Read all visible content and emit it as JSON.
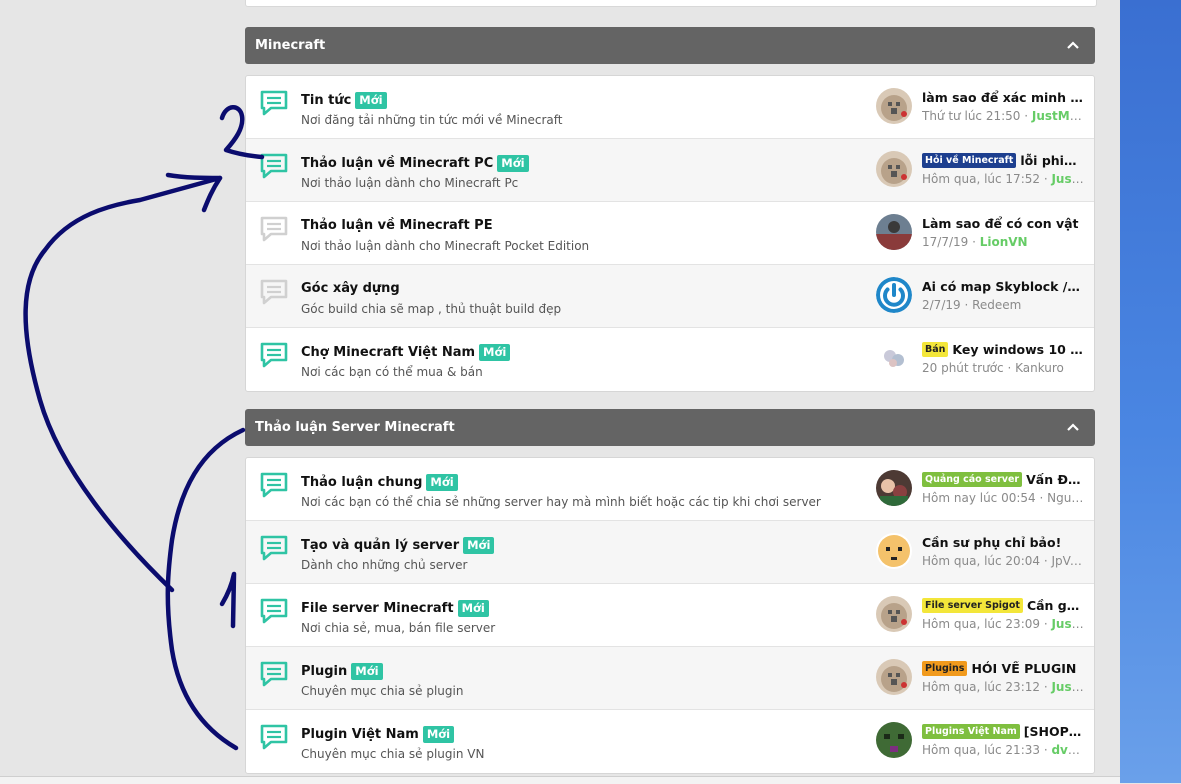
{
  "colors": {
    "accent": "#2fc4a4",
    "header_bg": "#646464",
    "ink": "#0b0c6e"
  },
  "sections": [
    {
      "title": "Minecraft",
      "nodes": [
        {
          "title": "Tin tức",
          "new": "Mới",
          "desc": "Nơi đăng tải những tin tức mới về Minecraft",
          "prefix": "",
          "prefix_bg": "",
          "prefix_fg": "",
          "last_title": "làm sao để xác minh v m...",
          "time": "Thứ tư lúc 21:50",
          "sep": " · ",
          "user": "JustMan...",
          "user_plain": false,
          "icon": "chat-bubble-unread-icon",
          "avatar": "creeper-avatar"
        },
        {
          "title": "Thảo luận về Minecraft PC",
          "new": "Mới",
          "desc": "Nơi thảo luận dành cho Minecraft Pc",
          "prefix": "Hỏi về Minecraft",
          "prefix_bg": "#1d3f8f",
          "prefix_fg": "#ffffff",
          "last_title": "lỗi phiên ...",
          "time": "Hôm qua, lúc 17:52",
          "sep": " · ",
          "user": "Just...",
          "user_plain": false,
          "icon": "chat-bubble-unread-icon",
          "avatar": "creeper-avatar"
        },
        {
          "title": "Thảo luận về Minecraft PE",
          "new": "",
          "desc": "Nơi thảo luận dành cho Minecraft Pocket Edition",
          "prefix": "",
          "prefix_bg": "",
          "prefix_fg": "",
          "last_title": "Làm sao để có con vật",
          "time": "17/7/19",
          "sep": " · ",
          "user": "LionVN",
          "user_plain": false,
          "icon": "chat-bubble-read-icon",
          "avatar": "photo-avatar"
        },
        {
          "title": "Góc xây dựng",
          "new": "",
          "desc": "Góc build chia sẽ map , thủ thuật build đẹp",
          "prefix": "",
          "prefix_bg": "",
          "prefix_fg": "",
          "last_title": "Ai có map Skyblock / Lo...",
          "time": "2/7/19",
          "sep": " · ",
          "user": "Redeem",
          "user_plain": true,
          "icon": "chat-bubble-read-icon",
          "avatar": "power-avatar"
        },
        {
          "title": "Chợ Minecraft Việt Nam",
          "new": "Mới",
          "desc": "Nơi các bạn có thể mua & bán",
          "prefix": "Bán",
          "prefix_bg": "#f3e63a",
          "prefix_fg": "#222222",
          "last_title": "Key windows 10 ed...",
          "time": "20 phút trước",
          "sep": " · ",
          "user": "Kankuro",
          "user_plain": true,
          "icon": "chat-bubble-unread-icon",
          "avatar": "snow-avatar"
        }
      ]
    },
    {
      "title": "Thảo luận Server Minecraft",
      "nodes": [
        {
          "title": "Thảo luận chung",
          "new": "Mới",
          "desc": "Nơi các bạn có thể chia sẻ những server hay mà mình biết hoặc các tip khi chơi server",
          "prefix": "Quảng cáo server",
          "prefix_bg": "#7fbf3f",
          "prefix_fg": "#ffffff",
          "last_title": "Vấn Đề C...",
          "time": "Hôm nay lúc 00:54",
          "sep": " · ",
          "user": "Nguye...",
          "user_plain": true,
          "icon": "chat-bubble-unread-icon",
          "avatar": "anime-avatar"
        },
        {
          "title": "Tạo và quản lý server",
          "new": "Mới",
          "desc": "Dành cho những chủ server",
          "prefix": "",
          "prefix_bg": "",
          "prefix_fg": "",
          "last_title": "Cần sư phụ chỉ bảo!",
          "time": "Hôm qua, lúc 20:04",
          "sep": " · ",
          "user": "JpVe...",
          "user_plain": true,
          "icon": "chat-bubble-unread-icon",
          "avatar": "face-avatar"
        },
        {
          "title": "File server Minecraft",
          "new": "Mới",
          "desc": "Nơi chia sẻ, mua, bán file server",
          "prefix": "File server Spigot",
          "prefix_bg": "#f3e63a",
          "prefix_fg": "#222222",
          "last_title": "Cần gấp ...",
          "time": "Hôm qua, lúc 23:09",
          "sep": " · ",
          "user": "Just...",
          "user_plain": false,
          "icon": "chat-bubble-unread-icon",
          "avatar": "creeper-avatar"
        },
        {
          "title": "Plugin",
          "new": "Mới",
          "desc": "Chuyên mục chia sẻ plugin",
          "prefix": "Plugins",
          "prefix_bg": "#f19a1d",
          "prefix_fg": "#222222",
          "last_title": "HỎI VỀ PLUGIN",
          "time": "Hôm qua, lúc 23:12",
          "sep": " · ",
          "user": "Just...",
          "user_plain": false,
          "icon": "chat-bubble-unread-icon",
          "avatar": "creeper-avatar"
        },
        {
          "title": "Plugin Việt Nam",
          "new": "Mới",
          "desc": "Chuyên mục chia sẻ plugin VN",
          "prefix": "Plugins Việt Nam",
          "prefix_bg": "#7fbf3f",
          "prefix_fg": "#ffffff",
          "last_title": "[SHOPG...",
          "time": "Hôm qua, lúc 21:33",
          "sep": " · ",
          "user": "dvmi",
          "user_plain": false,
          "icon": "chat-bubble-unread-icon",
          "avatar": "zombie-avatar"
        }
      ]
    }
  ],
  "annotations": {
    "label_1": "1",
    "label_2": "2"
  }
}
